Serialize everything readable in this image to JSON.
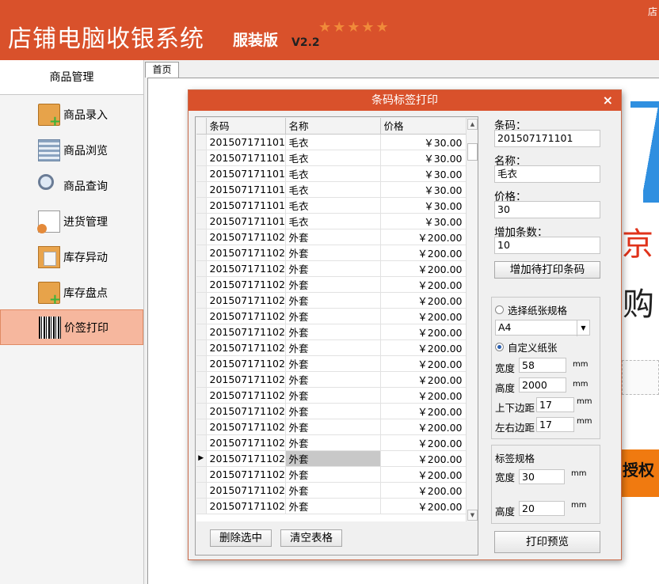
{
  "header": {
    "title": "店铺电脑收银系统",
    "edition": "服装版",
    "version": "V2.2",
    "stars": "★★★★★",
    "corner": "店"
  },
  "sidebar": {
    "title": "商品管理",
    "items": [
      {
        "label": "商品录入",
        "icon": "box-add-icon"
      },
      {
        "label": "商品浏览",
        "icon": "grid-list-icon"
      },
      {
        "label": "商品查询",
        "icon": "magnifier-icon"
      },
      {
        "label": "进货管理",
        "icon": "document-user-icon"
      },
      {
        "label": "库存异动",
        "icon": "folder-doc-icon"
      },
      {
        "label": "库存盘点",
        "icon": "box-add-icon"
      },
      {
        "label": "价签打印",
        "icon": "barcode-icon"
      }
    ]
  },
  "tabs": [
    {
      "label": "首页"
    }
  ],
  "background_text": {
    "red": "京",
    "black": "购",
    "orange": "授权"
  },
  "dialog": {
    "title": "条码标签打印",
    "close": "×",
    "grid": {
      "columns": [
        "条码",
        "名称",
        "价格"
      ],
      "current_row_marker": "▶",
      "rows": [
        {
          "barcode": "201507171101",
          "name": "毛衣",
          "price": "￥30.00"
        },
        {
          "barcode": "201507171101",
          "name": "毛衣",
          "price": "￥30.00"
        },
        {
          "barcode": "201507171101",
          "name": "毛衣",
          "price": "￥30.00"
        },
        {
          "barcode": "201507171101",
          "name": "毛衣",
          "price": "￥30.00"
        },
        {
          "barcode": "201507171101",
          "name": "毛衣",
          "price": "￥30.00"
        },
        {
          "barcode": "201507171101",
          "name": "毛衣",
          "price": "￥30.00"
        },
        {
          "barcode": "201507171102",
          "name": "外套",
          "price": "￥200.00"
        },
        {
          "barcode": "201507171102",
          "name": "外套",
          "price": "￥200.00"
        },
        {
          "barcode": "201507171102",
          "name": "外套",
          "price": "￥200.00"
        },
        {
          "barcode": "201507171102",
          "name": "外套",
          "price": "￥200.00"
        },
        {
          "barcode": "201507171102",
          "name": "外套",
          "price": "￥200.00"
        },
        {
          "barcode": "201507171102",
          "name": "外套",
          "price": "￥200.00"
        },
        {
          "barcode": "201507171102",
          "name": "外套",
          "price": "￥200.00"
        },
        {
          "barcode": "201507171102",
          "name": "外套",
          "price": "￥200.00"
        },
        {
          "barcode": "201507171102",
          "name": "外套",
          "price": "￥200.00"
        },
        {
          "barcode": "201507171102",
          "name": "外套",
          "price": "￥200.00"
        },
        {
          "barcode": "201507171102",
          "name": "外套",
          "price": "￥200.00"
        },
        {
          "barcode": "201507171102",
          "name": "外套",
          "price": "￥200.00"
        },
        {
          "barcode": "201507171102",
          "name": "外套",
          "price": "￥200.00"
        },
        {
          "barcode": "201507171102",
          "name": "外套",
          "price": "￥200.00"
        },
        {
          "barcode": "201507171102",
          "name": "外套",
          "price": "￥200.00",
          "selected": true
        },
        {
          "barcode": "201507171102",
          "name": "外套",
          "price": "￥200.00"
        },
        {
          "barcode": "201507171102",
          "name": "外套",
          "price": "￥200.00"
        },
        {
          "barcode": "201507171102",
          "name": "外套",
          "price": "￥200.00"
        }
      ]
    },
    "buttons": {
      "delete": "删除选中",
      "clear": "清空表格",
      "add": "增加待打印条码",
      "preview": "打印预览"
    },
    "form": {
      "barcode_label": "条码：",
      "barcode_value": "201507171101",
      "name_label": "名称：",
      "name_value": "毛衣",
      "price_label": "价格：",
      "price_value": "30",
      "count_label": "增加条数：",
      "count_value": "10"
    },
    "paper": {
      "standard_label": "选择纸张规格",
      "standard_value": "A4",
      "custom_label": "自定义纸张",
      "width_label": "宽度",
      "width_value": "58",
      "height_label": "高度",
      "height_value": "2000",
      "tb_margin_label": "上下边距",
      "tb_margin_value": "17",
      "lr_margin_label": "左右边距",
      "lr_margin_value": "17",
      "unit": "mm"
    },
    "label_spec": {
      "title": "标签规格",
      "width_label": "宽度",
      "width_value": "30",
      "height_label": "高度",
      "height_value": "20",
      "unit": "mm"
    }
  }
}
